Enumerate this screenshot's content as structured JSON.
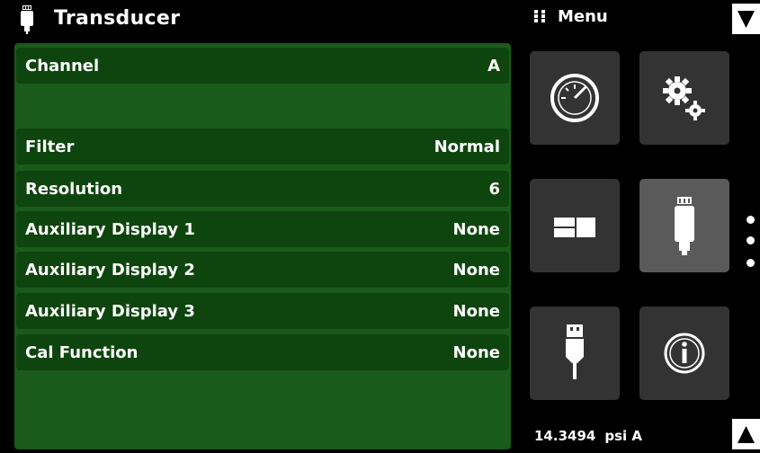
{
  "header": {
    "title": "Transducer",
    "icon": "transducer-icon"
  },
  "settings": [
    {
      "label": "Channel",
      "value": "A"
    },
    {
      "label": "Filter",
      "value": "Normal"
    },
    {
      "label": "Resolution",
      "value": "6"
    },
    {
      "label": "Auxiliary Display 1",
      "value": "None"
    },
    {
      "label": "Auxiliary Display 2",
      "value": "None"
    },
    {
      "label": "Auxiliary Display 3",
      "value": "None"
    },
    {
      "label": "Cal Function",
      "value": "None"
    }
  ],
  "menu": {
    "label": "Menu",
    "tiles": [
      {
        "icon": "gauge-icon"
      },
      {
        "icon": "gears-icon"
      },
      {
        "icon": "display-layout-icon"
      },
      {
        "icon": "transducer-icon",
        "selected": true
      },
      {
        "icon": "usb-icon"
      },
      {
        "icon": "info-icon"
      }
    ]
  },
  "status": {
    "pressure_value": "14.3494",
    "unit": "psi A"
  },
  "colors": {
    "panel": "#1a5a1a",
    "row": "#0e450e",
    "tile": "#333333",
    "tile_active": "#5a5a5a"
  }
}
